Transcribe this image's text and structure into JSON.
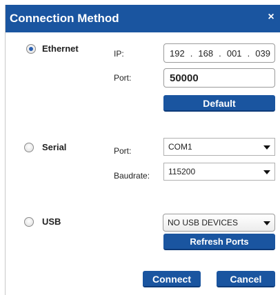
{
  "dialog": {
    "title": "Connection Method",
    "close_glyph": "×",
    "close_icon": "close-icon",
    "accent_color": "#1a55a0"
  },
  "ethernet": {
    "label": "Ethernet",
    "selected": true,
    "ip_label": "IP:",
    "ip_octets": [
      "192",
      "168",
      "001",
      "039"
    ],
    "port_label": "Port:",
    "port_value": "50000",
    "default_button": "Default"
  },
  "serial": {
    "label": "Serial",
    "selected": false,
    "port_label": "Port:",
    "port_value": "COM1",
    "baud_label": "Baudrate:",
    "baud_value": "115200"
  },
  "usb": {
    "label": "USB",
    "selected": false,
    "device_value": "NO USB DEVICES",
    "refresh_button": "Refresh Ports"
  },
  "footer": {
    "connect_button": "Connect",
    "cancel_button": "Cancel"
  }
}
